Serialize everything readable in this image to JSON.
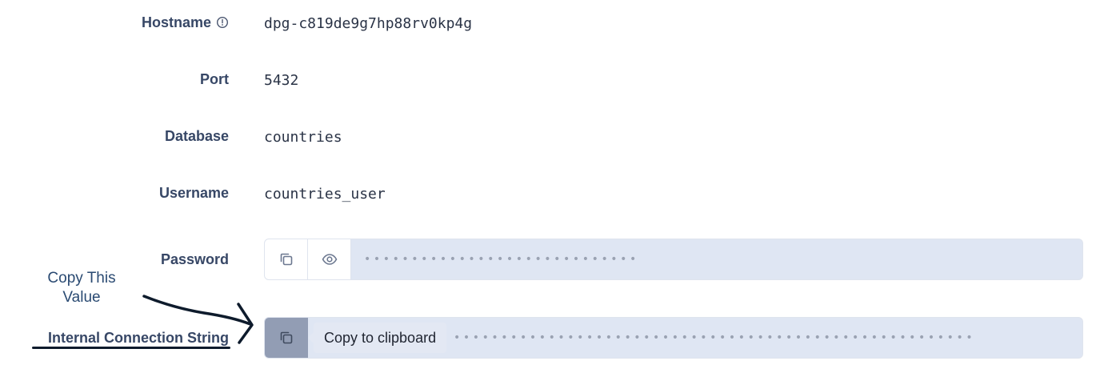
{
  "fields": {
    "hostname": {
      "label": "Hostname",
      "value": "dpg-c819de9g7hp88rv0kp4g"
    },
    "port": {
      "label": "Port",
      "value": "5432"
    },
    "database": {
      "label": "Database",
      "value": "countries"
    },
    "username": {
      "label": "Username",
      "value": "countries_user"
    },
    "password": {
      "label": "Password",
      "masked_value": "•••••••••••••••••••••••••••••"
    },
    "internal_connection_string": {
      "label": "Internal Connection String",
      "masked_value": "•••••••••••••••••••••••••••••••••••••••••••••••••••••••"
    }
  },
  "tooltip": {
    "text": "Copy to clipboard"
  },
  "annotation": {
    "line1": "Copy This",
    "line2": "Value"
  },
  "icons": {
    "hostname_info": "info-circle-icon",
    "copy": "copy-icon",
    "eye": "eye-icon"
  },
  "colors": {
    "label": "#374766",
    "field_background": "#dfe6f3",
    "active_copy_button": "#929db4",
    "annotation_text": "#2a4a72",
    "annotation_ink": "#0e1b2c"
  }
}
